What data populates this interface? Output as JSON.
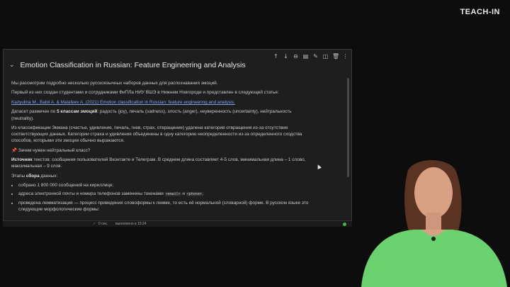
{
  "logo": "TEACH-IN",
  "toolbar": {
    "icons": [
      "arrow-up-icon",
      "arrow-down-icon",
      "link-icon",
      "comment-icon",
      "edit-icon",
      "mirror-icon",
      "delete-icon",
      "more-icon"
    ],
    "glyphs": [
      "↑",
      "↓",
      "⊖",
      "▤",
      "✎",
      "◫",
      "🗑",
      "⋮"
    ]
  },
  "heading": {
    "chevron": "⌄",
    "title": "Emotion Classification in Russian: Feature Engineering and Analysis"
  },
  "paragraphs": {
    "p1": "Мы рассмотрим подробно несколько русскоязычных наборов данных для распознавания эмоций.",
    "p2": "Первый из них создан студентами и сотрудниками ФиПЛа НИУ ВШЭ в Нижнем Новгороде и представлен в следующей статье:",
    "p3_link": "Kazyulina M., Babii A. & Malafeev A. (2021) Emotion classification in Russian: feature engineering and analysis.",
    "p4_pre": "Датасет размечен по ",
    "p4_bold": "5 классам эмоций",
    "p4_post": ": радость (joy), печаль (sadness), злость (anger), неуверенность (uncertainty), нейтральность (neutrality).",
    "p5": "Из классификации Экмана (счастье, удивление, печаль, гнев, страх, отвращение) удалена категория отвращения из-за отсутствия соответствующих данных. Категории страха и удивления объединены в одну категорию неопределенности из-за определенного сходства способов, которыми эти эмоции обычно выражаются.",
    "p6_icon": "📌",
    "p6": "Зачем нужен нейтральный класс?",
    "p7_bold": "Источник",
    "p7": " текстов: сообщения пользователей Вконтакте и Телеграм. В среднем длина составляет 4-5 слов, минимальная длина – 1 слово, максимальная – 9 слов.",
    "p8_pre": "Этапы ",
    "p8_bold": "сбора",
    "p8_post": " данных:"
  },
  "bullets": {
    "b1": "собрано 1 800 000 сообщений на кириллице;",
    "b2_pre": "адреса электронной почты и номера телефонов заменены токенами ",
    "b2_code1": "<email>",
    "b2_mid": " и ",
    "b2_code2": "<phone>",
    "b2_post": ";",
    "b3": "проведена лемматизация — процесс приведения словоформы к лемме, то есть её нормальной (словарной) форме. В русском языке это следующие морфологические формы:"
  },
  "status": {
    "check": "✓",
    "time": "0 сек.",
    "done": "выполнено в 15:24"
  },
  "colors": {
    "background": "#0d0d0d",
    "cell": "#1e1e1e",
    "link": "#7aa6e8",
    "status_ok": "#3fbf3f"
  }
}
